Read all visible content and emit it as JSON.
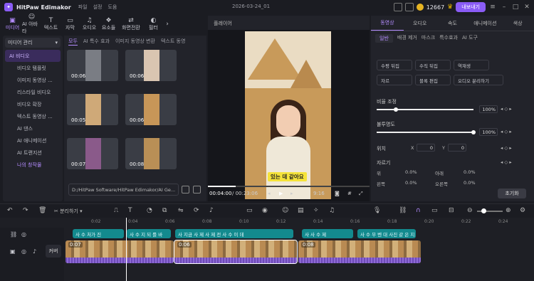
{
  "app": {
    "name": "HitPaw Edimakor",
    "menu": [
      "파일",
      "설정",
      "도움"
    ],
    "project": "2026-03-24_01",
    "credits": "12667",
    "upgrade": "내보내기"
  },
  "toolbar": {
    "items": [
      {
        "label": "미디어",
        "icon": "media-icon",
        "active": true
      },
      {
        "label": "AI 아바타",
        "icon": "avatar-icon"
      },
      {
        "label": "텍스트",
        "icon": "text-icon"
      },
      {
        "label": "자막",
        "icon": "subtitle-icon"
      },
      {
        "label": "오디오",
        "icon": "audio-icon"
      },
      {
        "label": "요소들",
        "icon": "elements-icon"
      },
      {
        "label": "화면전환",
        "icon": "transition-icon"
      },
      {
        "label": "필터",
        "icon": "filter-icon"
      }
    ]
  },
  "leftnav": {
    "header": "미디어 관리",
    "items": [
      "AI 비디오",
      "비디오 템플릿",
      "이미지 동영상 ...",
      "리스타일 비디오",
      "비디오 확장",
      "텍스트 동영상 ...",
      "AI 댄스",
      "AI 애니메이션",
      "AI 트랜지션",
      "나의 창작물"
    ]
  },
  "media": {
    "tabs": [
      "모두",
      "AI 특수 효과",
      "이미지 동영상 변환",
      "텍스트 동영"
    ],
    "thumbs": [
      {
        "dur": "00:06"
      },
      {
        "dur": "00:06"
      },
      {
        "dur": "00:05"
      },
      {
        "dur": "00:06"
      },
      {
        "dur": "00:07"
      },
      {
        "dur": "00:08"
      }
    ],
    "path": "D:/HitPaw Software/HitPaw Edimakor/AI Ge..."
  },
  "player": {
    "title": "플레이어",
    "subtitle": "있는 데 같아요",
    "time": "00:04:00",
    "total": "/ 00:23:06",
    "ratio": "9:16",
    "progress": 0.17
  },
  "rightpanel": {
    "tabs": [
      "동영상",
      "오디오",
      "속도",
      "애니메이션",
      "색상"
    ],
    "subtabs": [
      "일반",
      "배경 제거",
      "마스크",
      "특수효과",
      "AI 도구"
    ],
    "actions": [
      "수평 뒤집",
      "수직 뒤집",
      "역재생",
      "자르",
      "블록 편집",
      "오디오 분리하기"
    ],
    "opacity_label": "비율 조정",
    "opacity_val": "100%",
    "blur_label": "불투명도",
    "blur_val": "100%",
    "pos_label": "위치",
    "x_label": "X",
    "x_val": "0",
    "y_label": "Y",
    "y_val": "0",
    "crop_label": "자르기",
    "crop": [
      {
        "l": "위",
        "v": "0.0%"
      },
      {
        "l": "아래",
        "v": "0.0%"
      },
      {
        "l": "왼쪽",
        "v": "0.0%"
      },
      {
        "l": "오른쪽",
        "v": "0.0%"
      }
    ],
    "reset": "초기화"
  },
  "timeline": {
    "split_label": "분리하기",
    "ticks": [
      "0:02",
      "0:04",
      "0:06",
      "0:08",
      "0:10",
      "0:12",
      "0:14",
      "0:16",
      "0:18",
      "0:20",
      "0:22",
      "0:24"
    ],
    "captions": [
      "사 수 처가 진",
      "사 수 지 되 를 바",
      "사 지금 사 제 사 제 전 사 수 이 데",
      "사 사 수 제",
      "사 수 무 벤 대 사진 같 은 지"
    ],
    "clips": [
      {
        "dur": "0:07"
      },
      {
        "dur": "0:06"
      },
      {
        "dur": "0:08"
      }
    ],
    "cover": "커버"
  }
}
